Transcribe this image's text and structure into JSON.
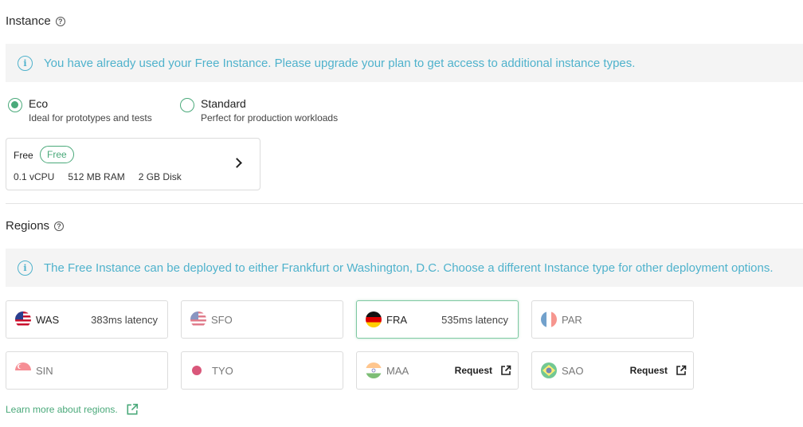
{
  "instance": {
    "title": "Instance",
    "banner": "You have already used your Free Instance. Please upgrade your plan to get access to additional instance types.",
    "options": [
      {
        "title": "Eco",
        "desc": "Ideal for prototypes and tests",
        "checked": true
      },
      {
        "title": "Standard",
        "desc": "Perfect for production workloads",
        "checked": false
      }
    ],
    "plan": {
      "name": "Free",
      "badge": "Free",
      "cpu": "0.1 vCPU",
      "ram": "512 MB RAM",
      "disk": "2 GB Disk"
    }
  },
  "regions": {
    "title": "Regions",
    "banner": "The Free Instance can be deployed to either Frankfurt or Washington, D.C. Choose a different Instance type for other deployment options.",
    "items": [
      {
        "code": "WAS",
        "latency": "383ms latency",
        "flag": "us-flag-icon"
      },
      {
        "code": "SFO",
        "flag": "us-flag-icon"
      },
      {
        "code": "FRA",
        "latency": "535ms latency",
        "flag": "germany-flag-icon"
      },
      {
        "code": "PAR",
        "flag": "france-flag-icon"
      },
      {
        "code": "SIN",
        "flag": "singapore-flag-icon"
      },
      {
        "code": "TYO",
        "flag": "japan-flag-icon"
      },
      {
        "code": "MAA",
        "action": "Request",
        "flag": "india-flag-icon"
      },
      {
        "code": "SAO",
        "action": "Request",
        "flag": "brazil-flag-icon"
      }
    ],
    "learn_more": "Learn more about regions."
  },
  "colors": {
    "accent": "#4aa97a",
    "info": "#4fb2cc",
    "banner_bg": "#f4f4f4"
  }
}
